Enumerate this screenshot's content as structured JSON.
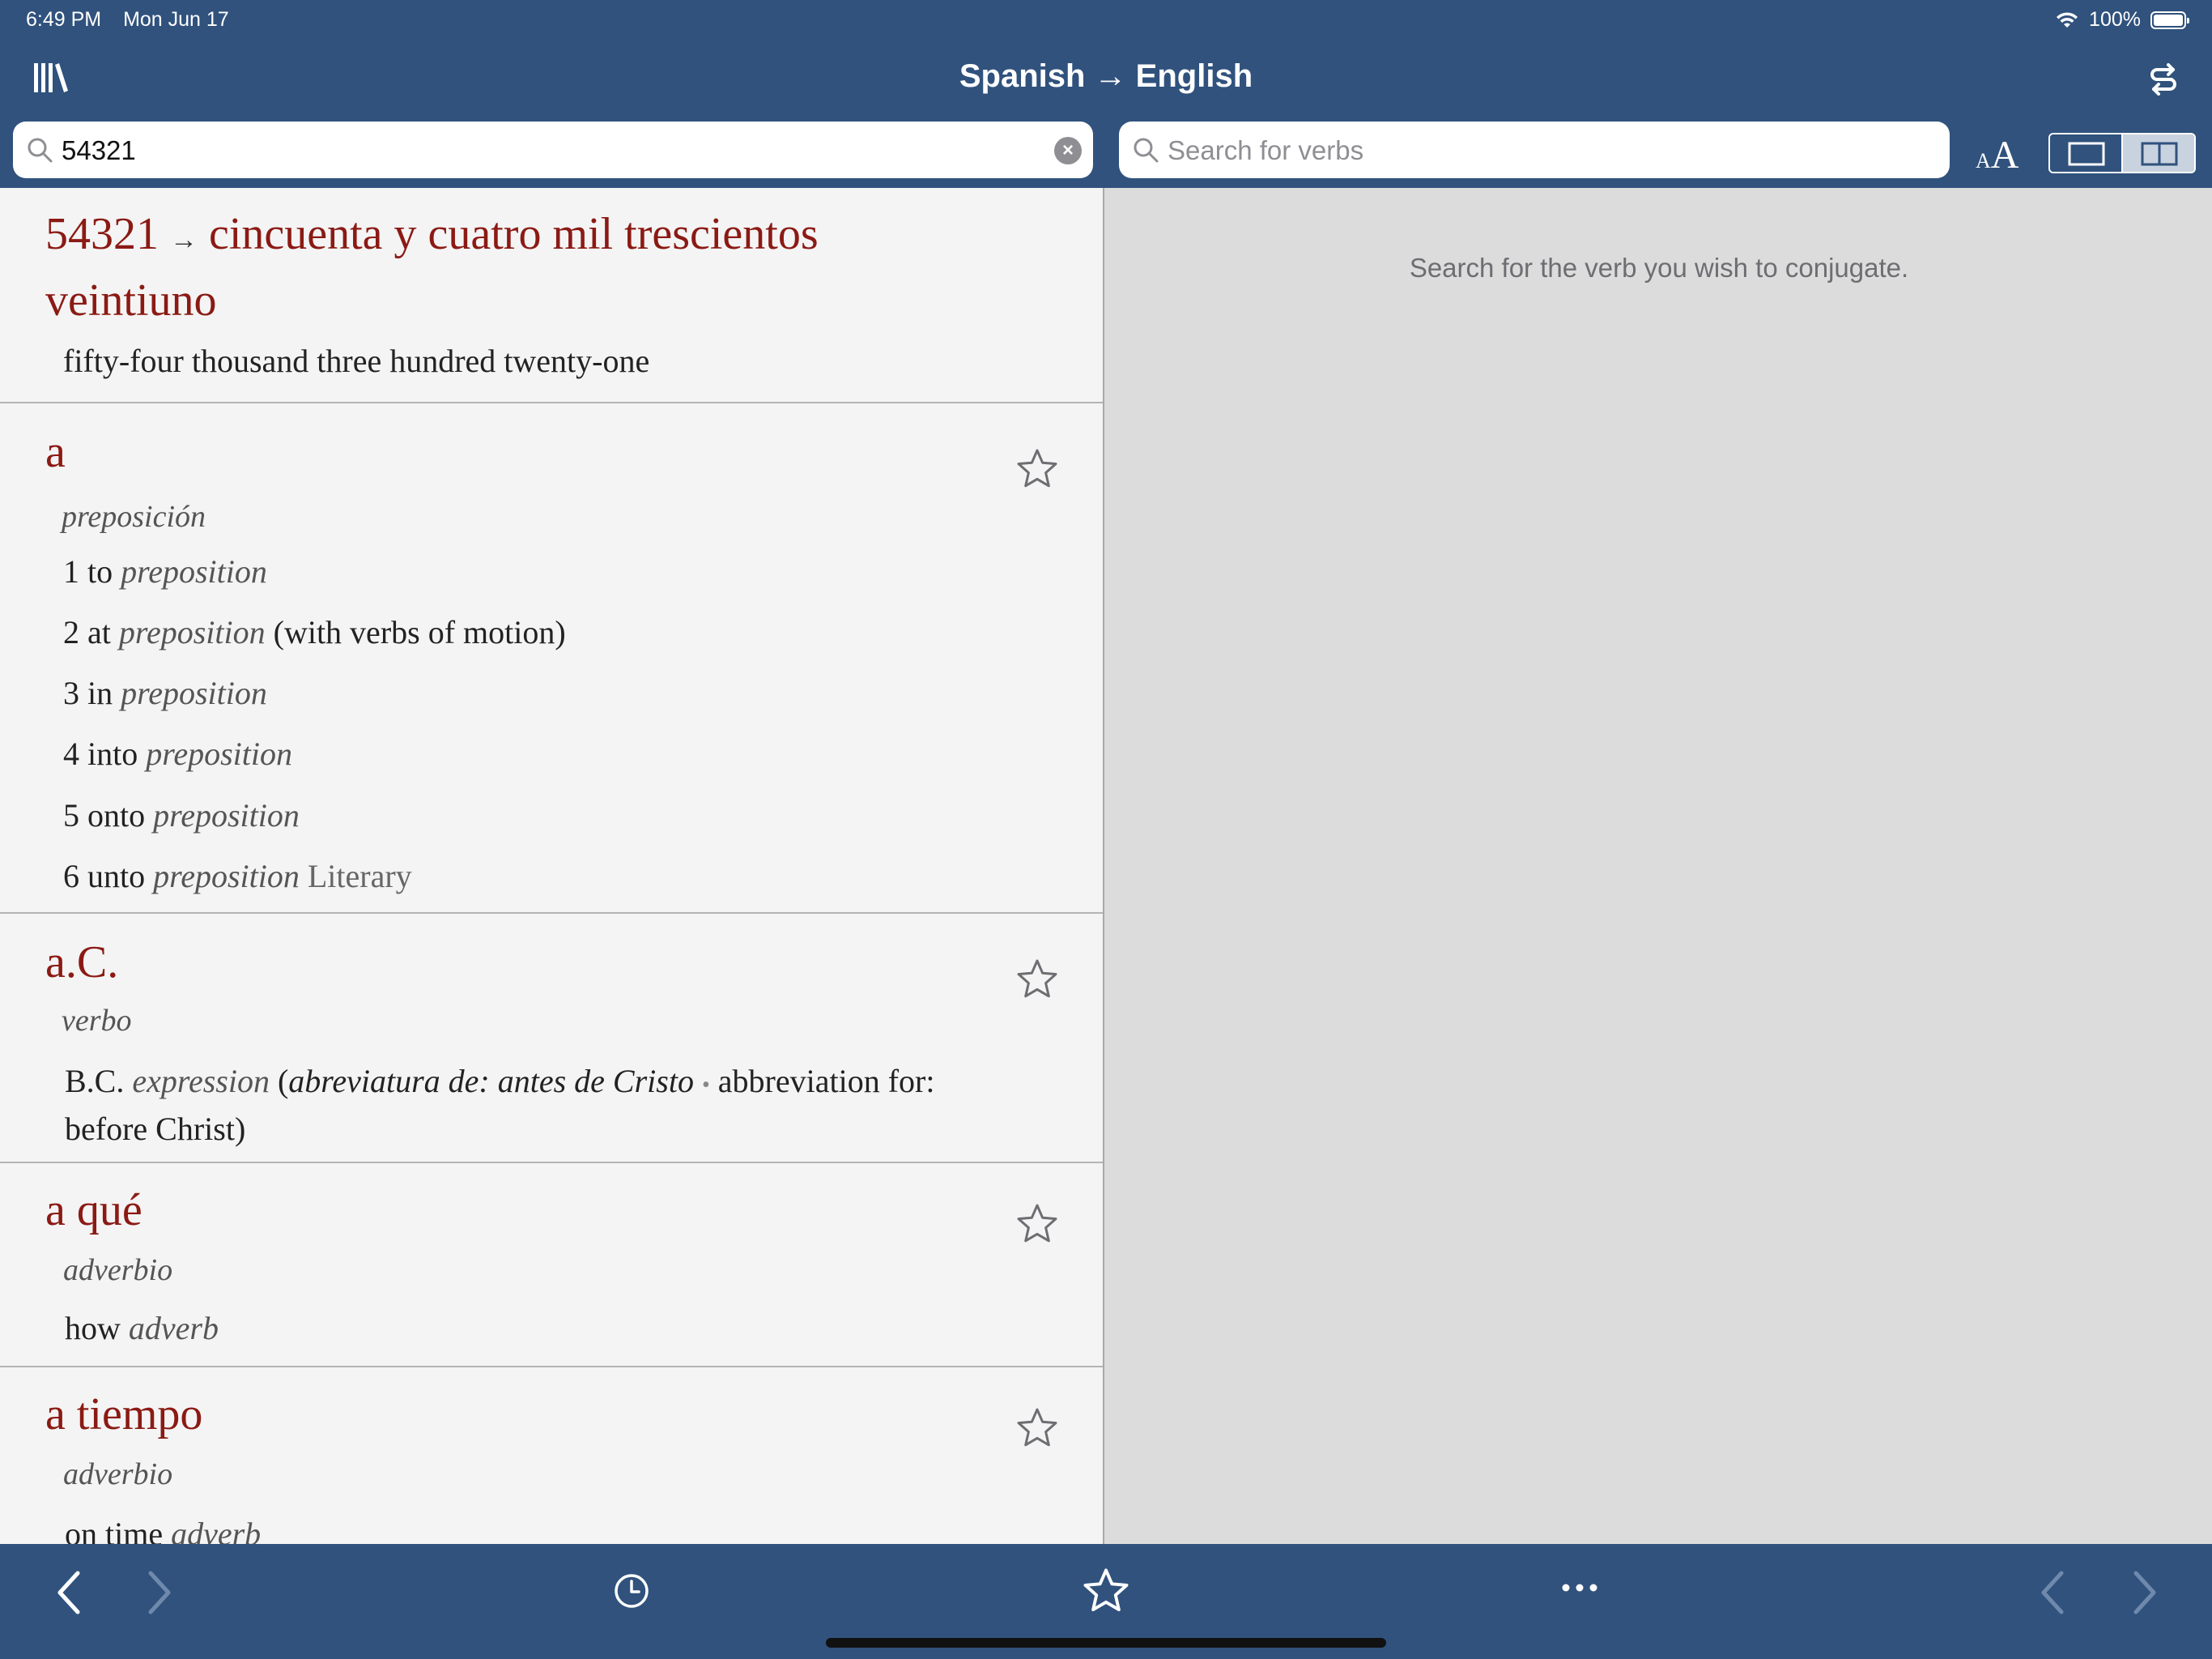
{
  "status": {
    "time": "6:49 PM",
    "date": "Mon Jun 17",
    "battery": "100%"
  },
  "nav": {
    "title": "Spanish → English"
  },
  "search": {
    "value": "54321",
    "verb_placeholder": "Search for verbs"
  },
  "font_control": {
    "small": "A",
    "big": "A"
  },
  "verb_pane": {
    "hint": "Search for the verb you wish to conjugate."
  },
  "number_entry": {
    "number": "54321",
    "arrow": "→",
    "spanish": "cincuenta y cuatro mil trescientos",
    "spanish_cont": "veintiuno",
    "english": "fifty-four thousand three hundred twenty-one"
  },
  "entries": [
    {
      "headword": "a",
      "pos": "preposición",
      "defs": [
        {
          "num": "1",
          "text": "to",
          "label": "preposition",
          "extra": ""
        },
        {
          "num": "2",
          "text": "at",
          "label": "preposition",
          "extra": "(with verbs of motion)"
        },
        {
          "num": "3",
          "text": "in",
          "label": "preposition",
          "extra": ""
        },
        {
          "num": "4",
          "text": "into",
          "label": "preposition",
          "extra": ""
        },
        {
          "num": "5",
          "text": "onto",
          "label": "preposition",
          "extra": ""
        },
        {
          "num": "6",
          "text": "unto",
          "label": "preposition",
          "extra": "Literary"
        }
      ]
    },
    {
      "headword": "a.C.",
      "pos": "verbo",
      "def_text": "B.C.",
      "def_label": "expression",
      "def_open": "(",
      "def_italic": "abreviatura de: antes de Cristo",
      "def_dot": "•",
      "def_rest": "abbreviation for:",
      "def_rest2": "before Christ)"
    },
    {
      "headword": "a qué",
      "pos": "adverbio",
      "def_text": "how",
      "def_label": "adverb"
    },
    {
      "headword": "a tiempo",
      "pos": "adverbio",
      "def_text": "on time",
      "def_label": "adverb"
    }
  ]
}
